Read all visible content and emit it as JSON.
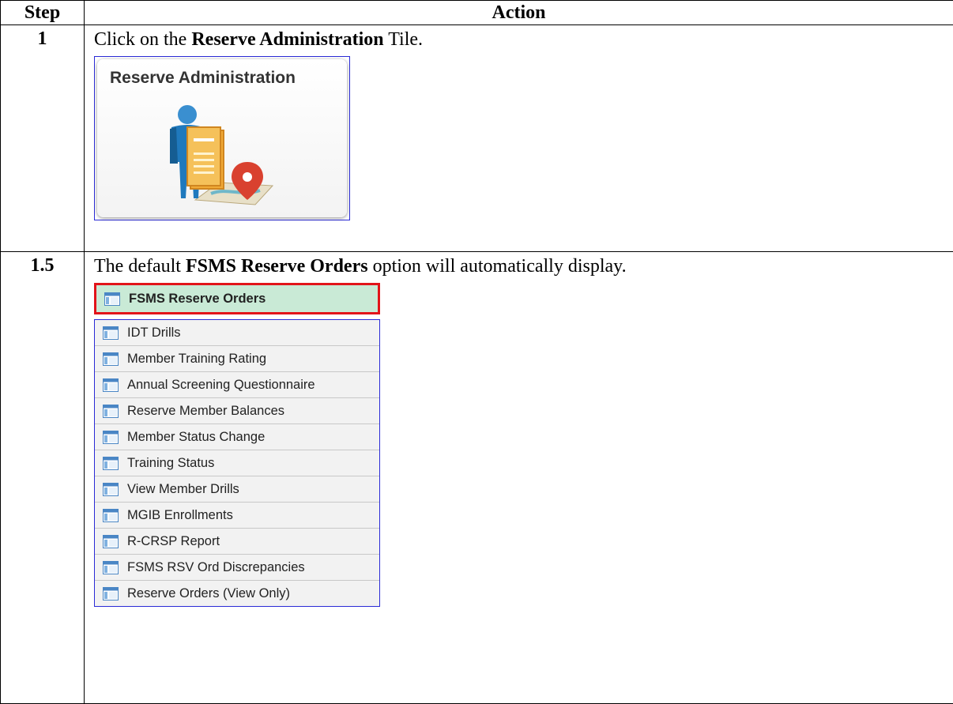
{
  "table": {
    "header_step": "Step",
    "header_action": "Action"
  },
  "step1": {
    "number": "1",
    "text_before": "Click on the ",
    "text_bold": "Reserve Administration",
    "text_after": " Tile.",
    "tile_title": "Reserve Administration",
    "tile_icon": "reserve-admin-person-document-map-pin-icon"
  },
  "step2": {
    "number": "1.5",
    "text_before": "The default ",
    "text_bold": "FSMS Reserve Orders",
    "text_after": " option will automatically display.",
    "menu_icon": "page-list-icon",
    "active_item": "FSMS Reserve Orders",
    "items": [
      "IDT Drills",
      "Member Training Rating",
      "Annual Screening Questionnaire",
      "Reserve Member Balances",
      "Member Status Change",
      "Training Status",
      "View Member Drills",
      "MGIB Enrollments",
      "R-CRSP Report",
      "FSMS RSV Ord Discrepancies",
      "Reserve Orders (View Only)"
    ]
  },
  "colors": {
    "active_bg": "#c9ead6",
    "active_border": "#e2141a",
    "frame_border": "#2b2bd6",
    "item_bg": "#f2f2f2"
  }
}
